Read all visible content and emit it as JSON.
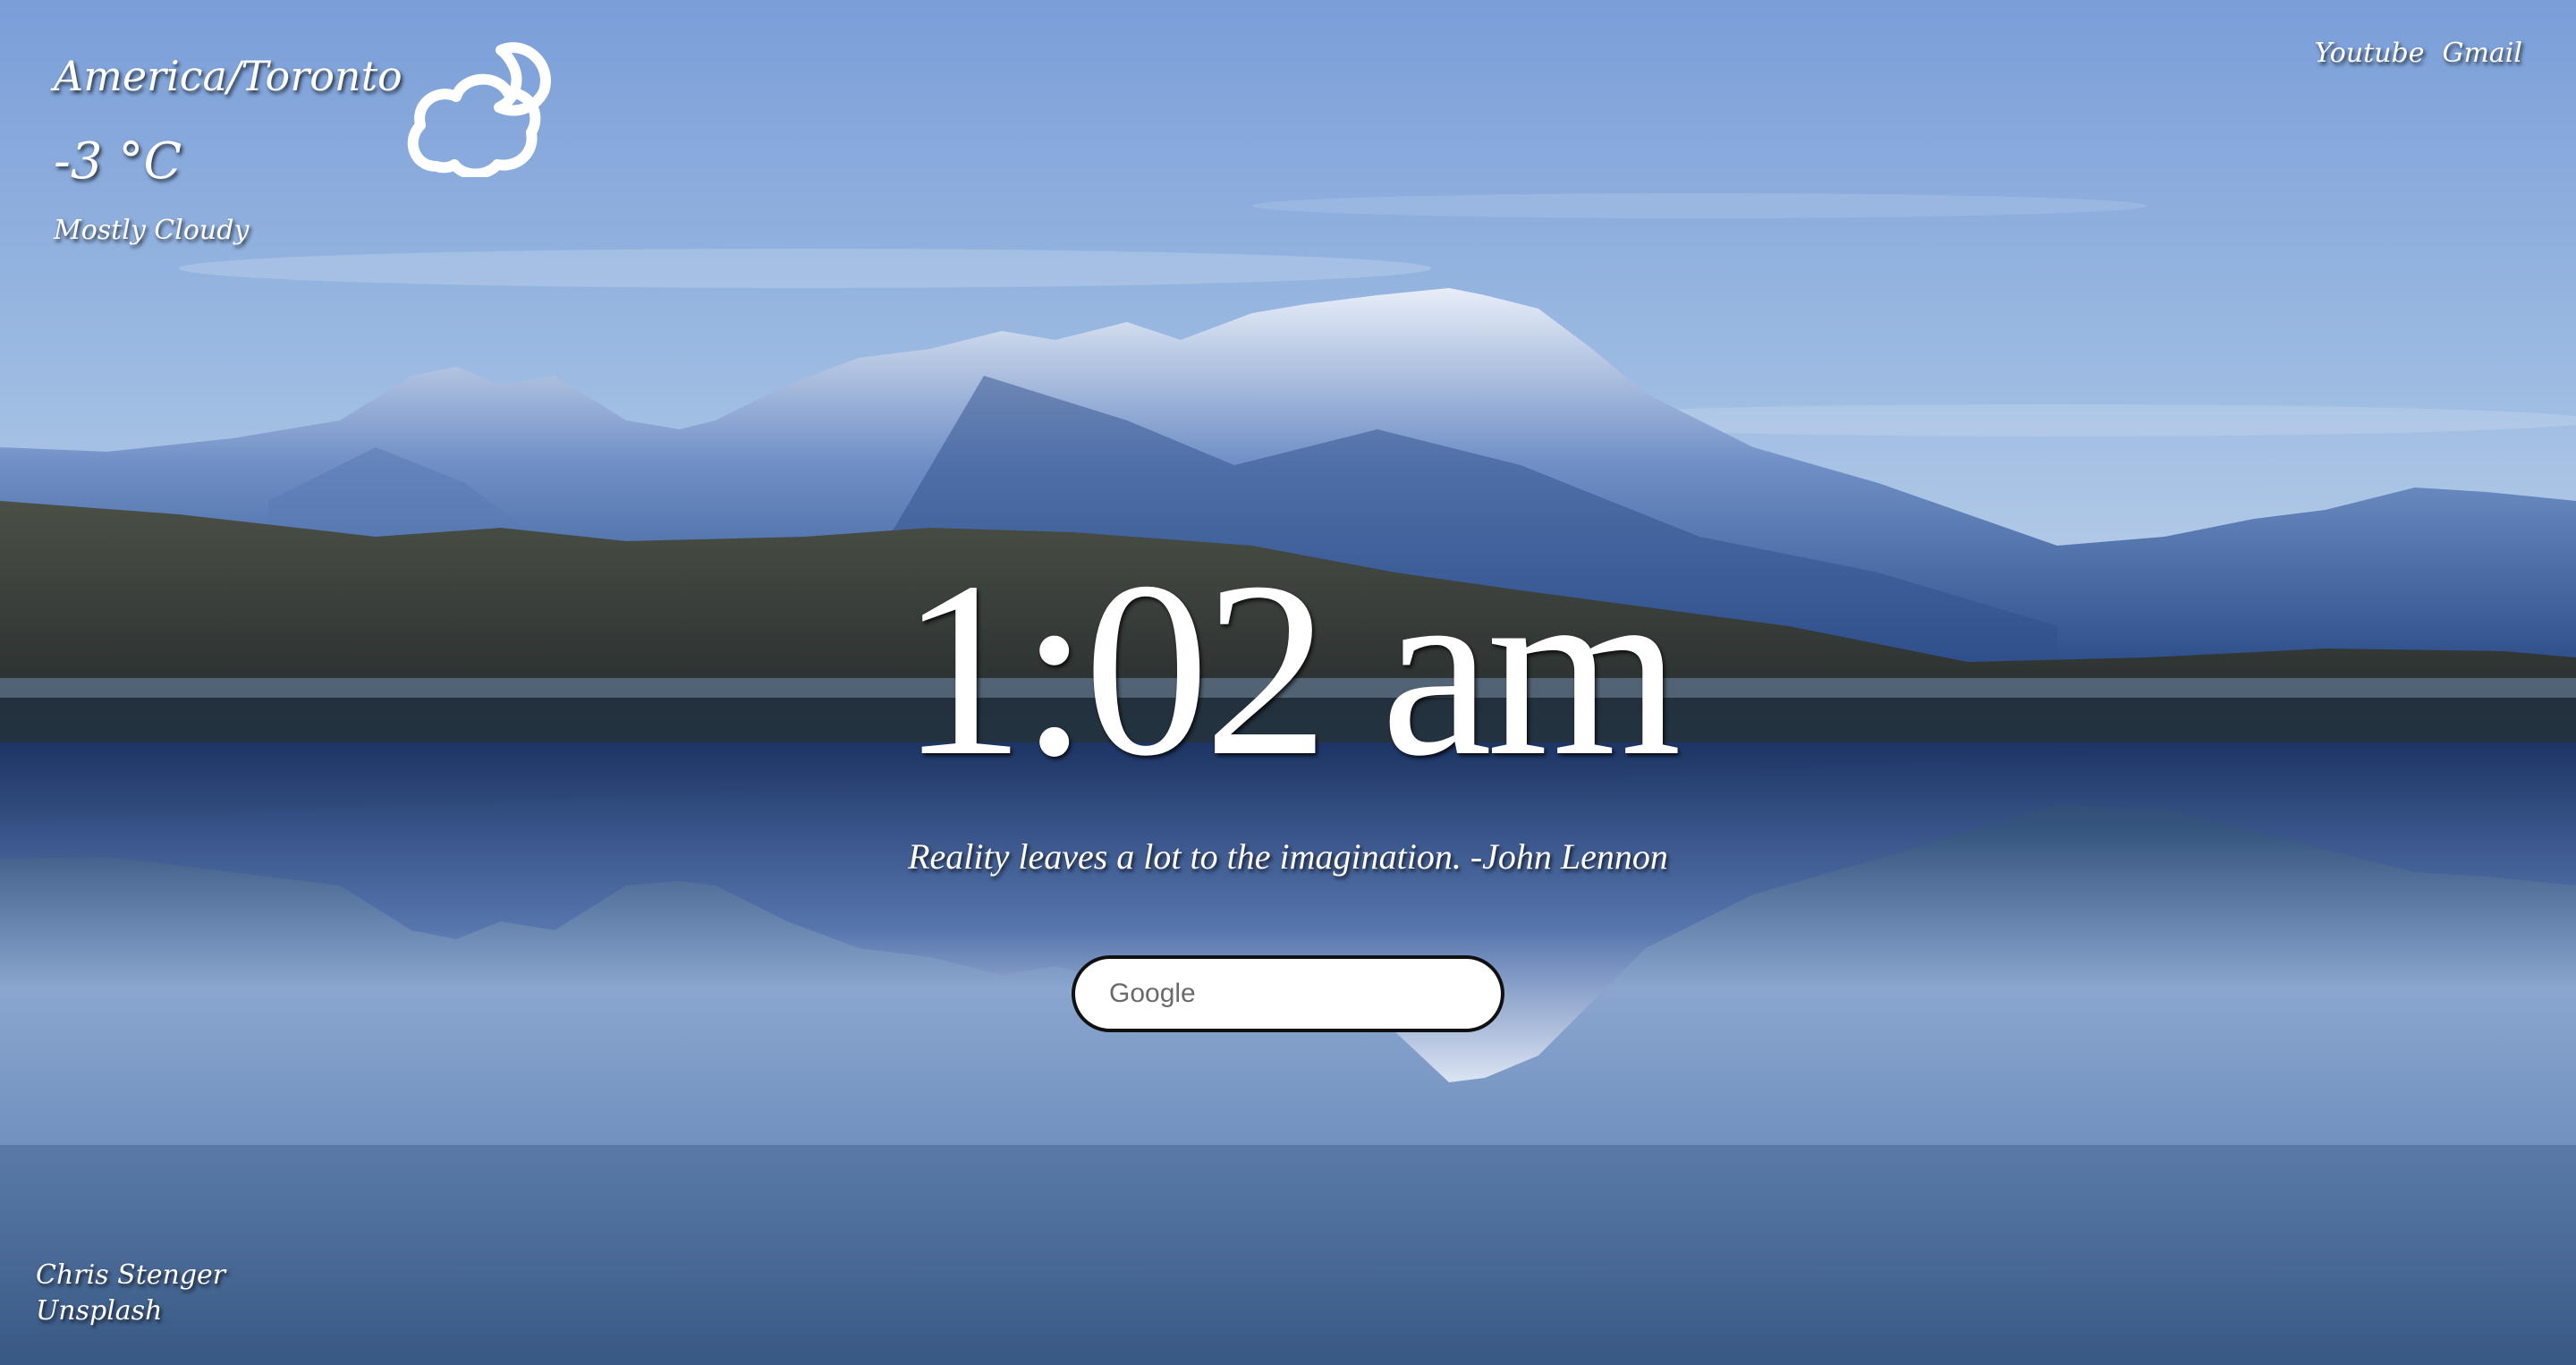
{
  "weather": {
    "location": "America/Toronto",
    "temperature": "-3 °C",
    "condition": "Mostly Cloudy",
    "icon": "cloudy-night-icon"
  },
  "links": {
    "youtube": "Youtube",
    "gmail": "Gmail"
  },
  "clock": {
    "time": "1:02 am"
  },
  "quote": {
    "text": "Reality leaves a lot to the imagination. -John Lennon"
  },
  "search": {
    "placeholder": "Google",
    "value": ""
  },
  "credit": {
    "photographer": "Chris Stenger",
    "source": "Unsplash"
  },
  "colors": {
    "text": "#ffffff",
    "search_border": "#111111",
    "sky_top": "#7ea0d6",
    "water": "#4a6e9e"
  }
}
